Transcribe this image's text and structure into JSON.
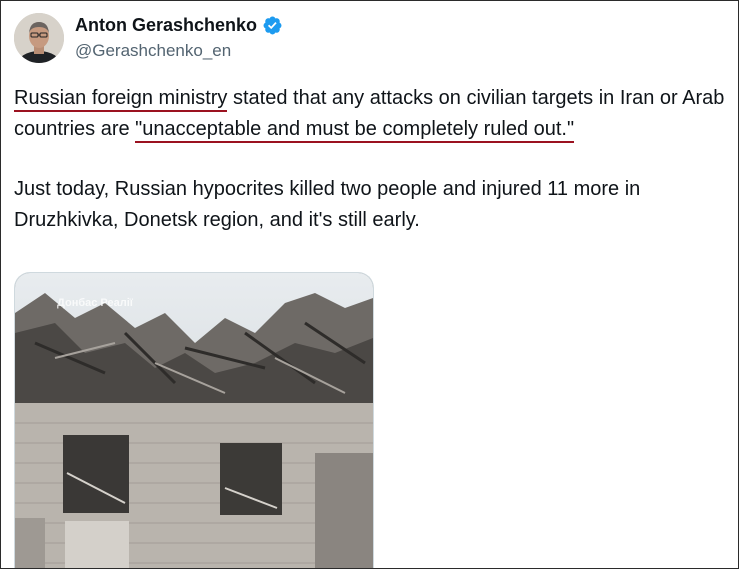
{
  "author": {
    "name": "Anton Gerashchenko",
    "handle": "@Gerashchenko_en",
    "verified_icon": "verified-badge-icon",
    "verified_color": "#1d9bf0"
  },
  "tweet": {
    "p1_part1": "Russian foreign ministry",
    "p1_part2": " stated that any attacks on civilian targets in Iran or Arab countries are ",
    "p1_part3": "\"unacceptable and must be completely ruled out.\"",
    "p2": "Just today, Russian hypocrites killed two people and injured 11 more in Druzhkivka, Donetsk region, and it's still early."
  },
  "media": {
    "watermark": "Донбас Реалії"
  },
  "colors": {
    "underline": "#9b1220",
    "text": "#0f1419",
    "muted": "#536471"
  }
}
